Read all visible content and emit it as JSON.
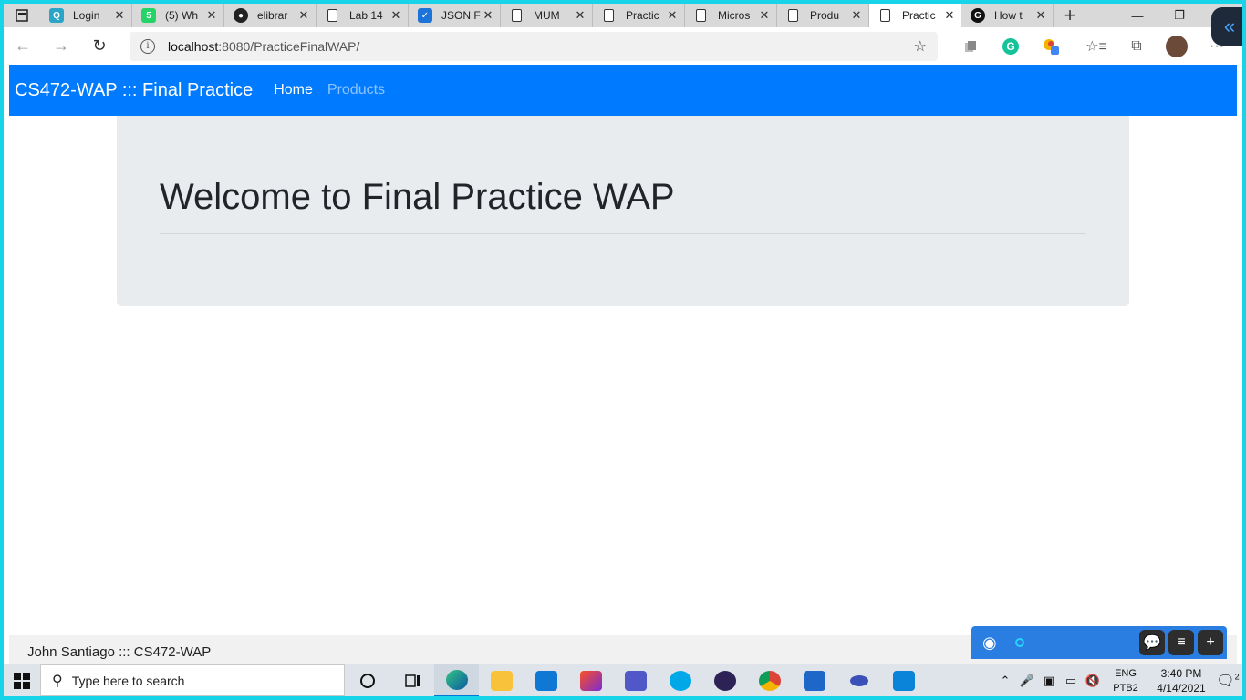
{
  "browser": {
    "tabs": [
      {
        "title": "Login",
        "favicon": "q-icon",
        "color": "#2aa5c7",
        "glyph": "Q"
      },
      {
        "title": "(5) Wh",
        "favicon": "whatsapp-icon",
        "color": "#25d366",
        "glyph": "5"
      },
      {
        "title": "elibrar",
        "favicon": "github-icon",
        "color": "#222222",
        "glyph": "●"
      },
      {
        "title": "Lab 14",
        "favicon": "page-icon",
        "color": "",
        "glyph": ""
      },
      {
        "title": "JSON F",
        "favicon": "checkbox-icon",
        "color": "#1e73d8",
        "glyph": "✓"
      },
      {
        "title": "MUM",
        "favicon": "page-icon",
        "color": "",
        "glyph": ""
      },
      {
        "title": "Practic",
        "favicon": "page-icon",
        "color": "",
        "glyph": ""
      },
      {
        "title": "Micros",
        "favicon": "page-icon",
        "color": "",
        "glyph": ""
      },
      {
        "title": "Produ",
        "favicon": "page-icon",
        "color": "",
        "glyph": ""
      },
      {
        "title": "Practic",
        "favicon": "page-icon",
        "color": "",
        "glyph": "",
        "active": true
      },
      {
        "title": "How t",
        "favicon": "g-icon",
        "color": "#111111",
        "glyph": "G"
      }
    ],
    "url_host": "localhost",
    "url_path": ":8080/PracticeFinalWAP/"
  },
  "site": {
    "brand": "CS472-WAP ::: Final Practice",
    "nav": {
      "home": "Home",
      "products": "Products"
    },
    "heading": "Welcome to Final Practice WAP",
    "footer": "John Santiago ::: CS472-WAP",
    "accent_color": "#007bff"
  },
  "taskbar": {
    "search_placeholder": "Type here to search",
    "lang_top": "ENG",
    "lang_bottom": "PTB2",
    "time": "3:40 PM",
    "date": "4/14/2021",
    "notification_count": "2"
  }
}
